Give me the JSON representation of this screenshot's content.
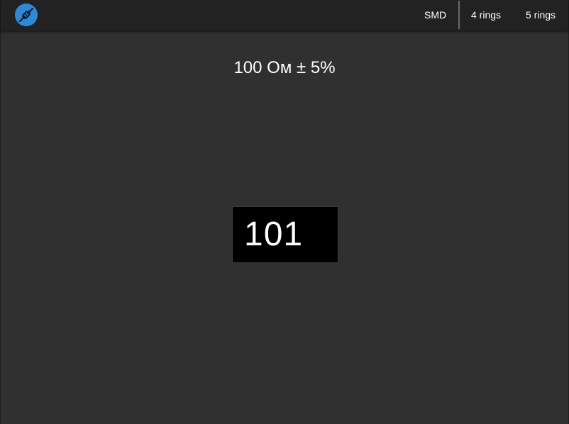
{
  "header": {
    "app_icon": "resistor-icon",
    "tabs": [
      {
        "label": "SMD",
        "active": true
      },
      {
        "label": "4 rings",
        "active": false
      },
      {
        "label": "5 rings",
        "active": false
      }
    ]
  },
  "result": {
    "text": "100 Ом ± 5%"
  },
  "smd": {
    "code": "101"
  },
  "colors": {
    "background": "#303030",
    "toolbar": "#222222",
    "accent": "#2d8ad8",
    "chip": "#000000",
    "text": "#ffffff"
  }
}
